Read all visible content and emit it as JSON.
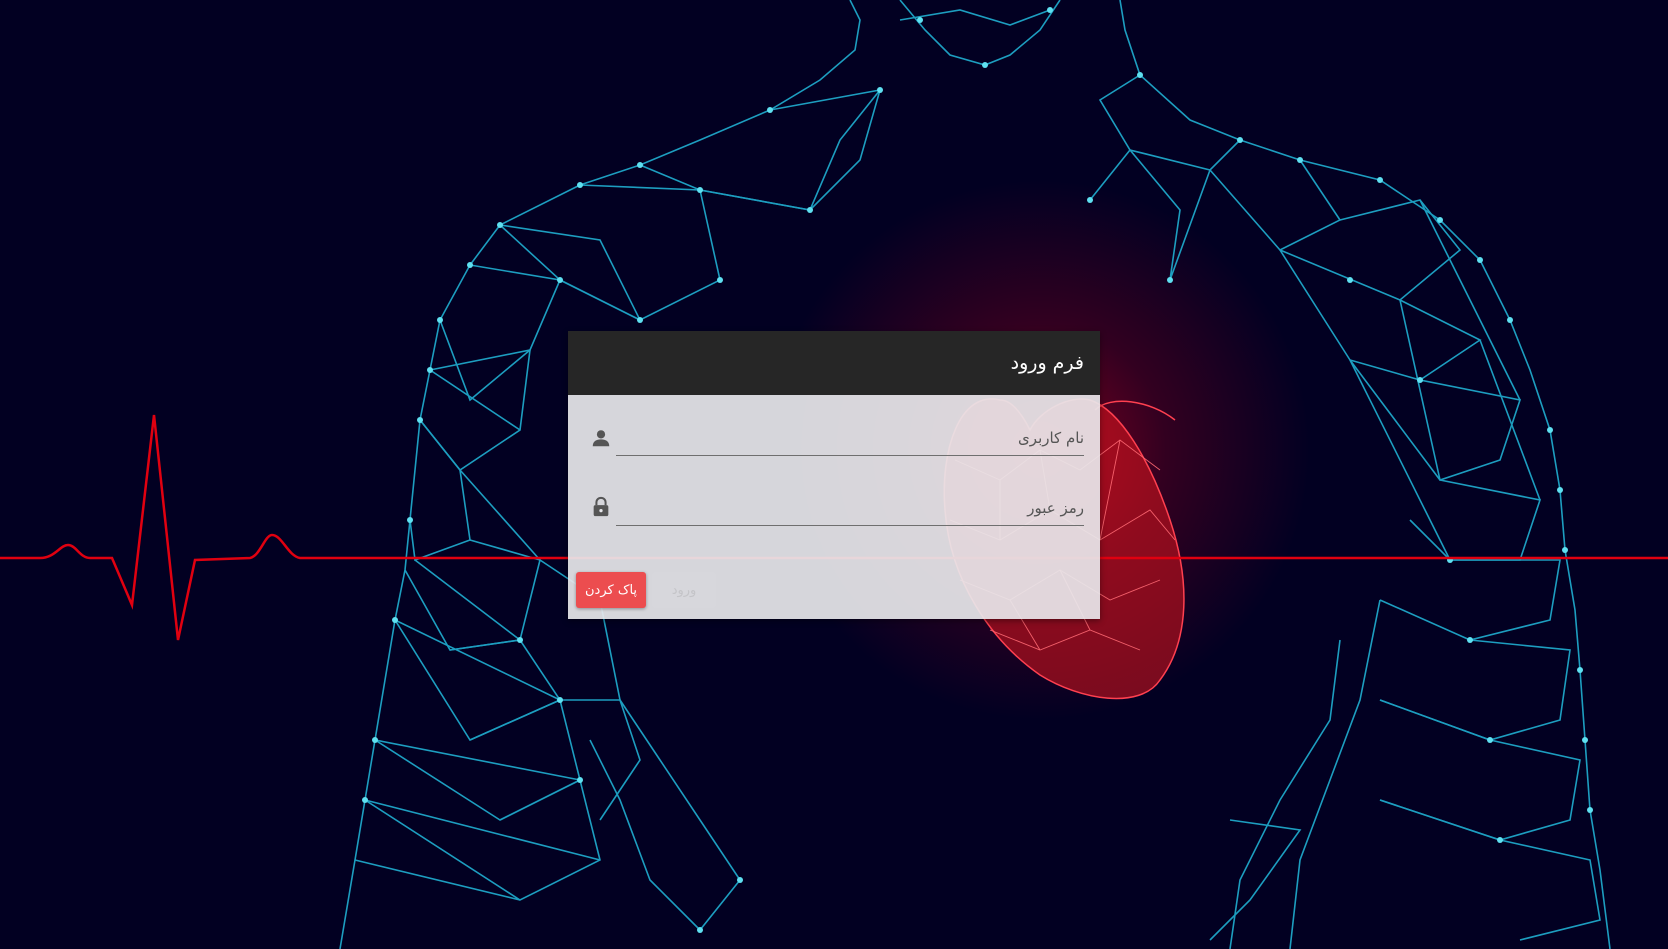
{
  "colors": {
    "background": "#020022",
    "wireframe": "#1fa7c9",
    "heartbeat_line": "#e00010",
    "header_bg": "#262626",
    "clear_button": "#ec4d4f"
  },
  "login_form": {
    "title": "فرم ورود",
    "username": {
      "placeholder": "نام کاربری",
      "value": "",
      "icon": "user-icon"
    },
    "password": {
      "placeholder": "رمز عبور",
      "value": "",
      "icon": "lock-icon"
    },
    "login_button_label": "ورود",
    "login_button_state": "disabled",
    "clear_button_label": "پاک کردن"
  }
}
